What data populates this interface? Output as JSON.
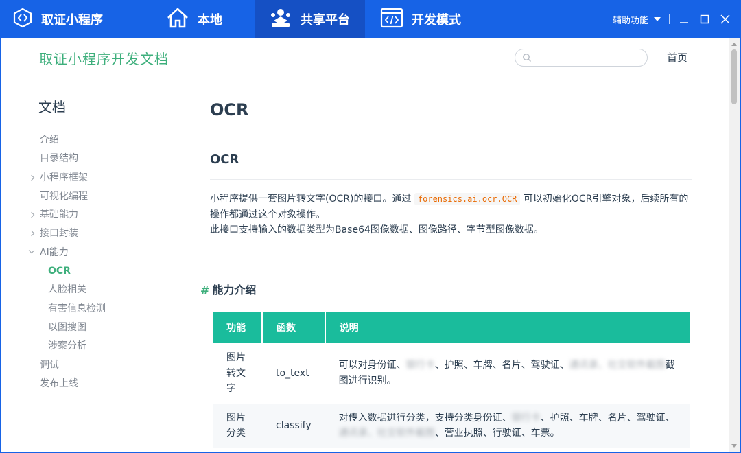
{
  "titlebar": {
    "brand": "取证小程序",
    "tabs": [
      {
        "label": "本地",
        "icon": "home-icon"
      },
      {
        "label": "共享平台",
        "icon": "share-platform-icon",
        "active": true
      },
      {
        "label": "开发模式",
        "icon": "code-icon"
      }
    ],
    "assist_label": "辅助功能"
  },
  "header": {
    "site_title": "取证小程序开发文档",
    "search_placeholder": "",
    "home_link": "首页"
  },
  "sidebar": {
    "heading": "文档",
    "items": [
      {
        "label": "介绍",
        "chevron": "none"
      },
      {
        "label": "目录结构",
        "chevron": "none"
      },
      {
        "label": "小程序框架",
        "chevron": "right"
      },
      {
        "label": "可视化编程",
        "chevron": "none"
      },
      {
        "label": "基础能力",
        "chevron": "right"
      },
      {
        "label": "接口封装",
        "chevron": "right"
      },
      {
        "label": "AI能力",
        "chevron": "down"
      },
      {
        "label": "OCR",
        "sub": true,
        "active": true
      },
      {
        "label": "人脸相关",
        "sub": true
      },
      {
        "label": "有害信息检测",
        "sub": true
      },
      {
        "label": "以图搜图",
        "sub": true
      },
      {
        "label": "涉案分析",
        "sub": true
      },
      {
        "label": "调试",
        "chevron": "none"
      },
      {
        "label": "发布上线",
        "chevron": "none"
      }
    ]
  },
  "content": {
    "page_title": "OCR",
    "section_title": "OCR",
    "para1_before": "小程序提供一套图片转文字(OCR)的接口。通过",
    "para1_code": "forensics.ai.ocr.OCR",
    "para1_after": "可以初始化OCR引擎对象，后续所有的操作都通过这个对象操作。",
    "para2": "此接口支持输入的数据类型为Base64图像数据、图像路径、字节型图像数据。",
    "subsection_hash": "#",
    "subsection_title": "能力介绍"
  },
  "table": {
    "headers": [
      "功能",
      "函数",
      "说明"
    ],
    "rows": [
      {
        "feature": "图片转文字",
        "function": "to_text",
        "desc_a": "可以对身份证、",
        "desc_blur_a": "银行卡",
        "desc_b": "、护照、车牌、名片、驾驶证、",
        "desc_blur_b": "通讯录、社交软件截图",
        "desc_c": "截图进行识别。"
      },
      {
        "feature": "图片分类",
        "function": "classify",
        "desc_a": "对传入数据进行分类，支持分类身份证、",
        "desc_blur_a": "银行卡",
        "desc_b": "、护照、车牌、名片、驾驶证、",
        "desc_blur_b": "通讯录、社交软件截图",
        "desc_c": "、营业执照、行驶证、车票。"
      }
    ]
  },
  "colors": {
    "titlebar_bg": "#1763e6",
    "active_tab_bg": "#1550c4",
    "accent_green": "#3eaf7c",
    "table_header_bg": "#1abc9c"
  }
}
